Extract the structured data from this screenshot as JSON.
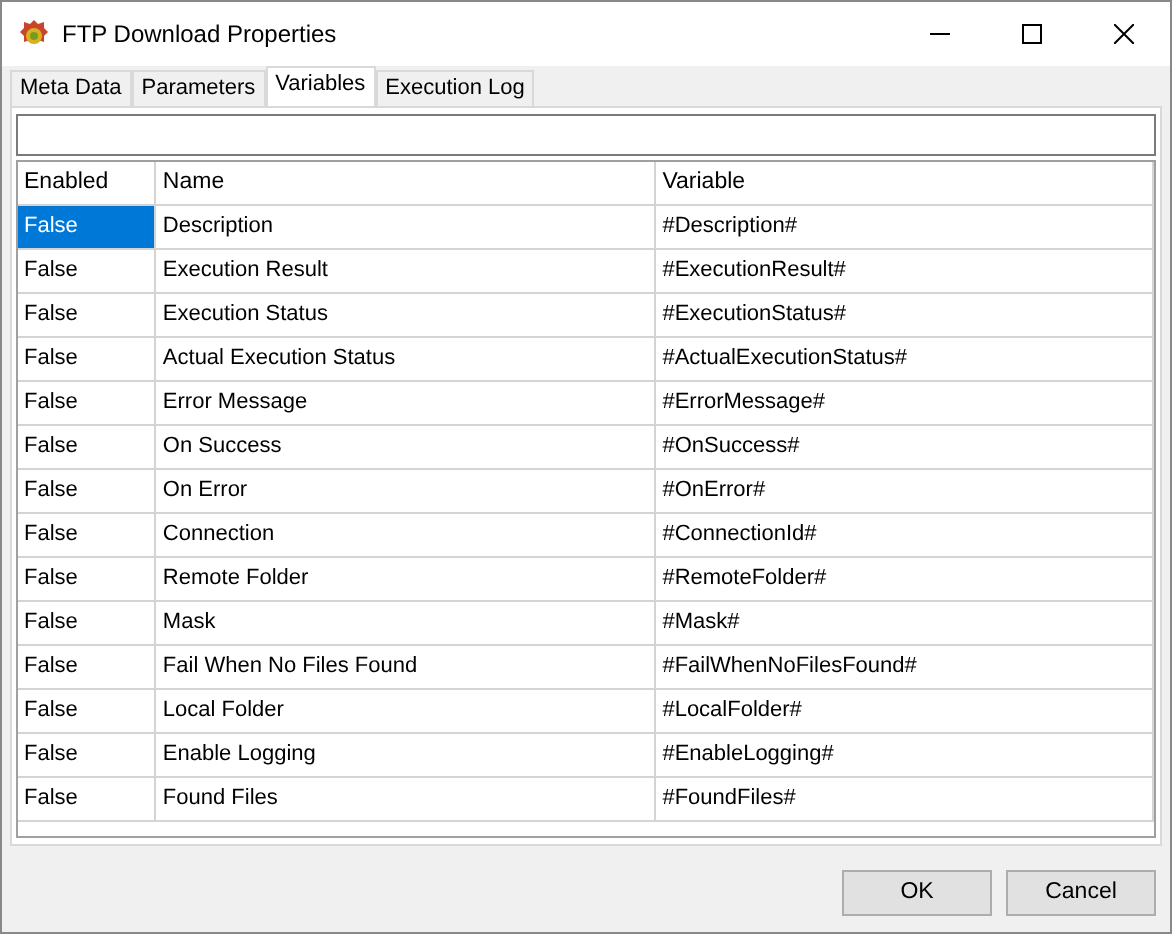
{
  "window": {
    "title": "FTP Download Properties"
  },
  "tabs": [
    {
      "label": "Meta Data",
      "selected": false
    },
    {
      "label": "Parameters",
      "selected": false
    },
    {
      "label": "Variables",
      "selected": true
    },
    {
      "label": "Execution Log",
      "selected": false
    }
  ],
  "table": {
    "columns": [
      "Enabled",
      "Name",
      "Variable"
    ],
    "rows": [
      {
        "enabled": "False",
        "name": "Description",
        "variable": "#Description#",
        "selected": true
      },
      {
        "enabled": "False",
        "name": "Execution Result",
        "variable": "#ExecutionResult#",
        "selected": false
      },
      {
        "enabled": "False",
        "name": "Execution Status",
        "variable": "#ExecutionStatus#",
        "selected": false
      },
      {
        "enabled": "False",
        "name": "Actual Execution Status",
        "variable": "#ActualExecutionStatus#",
        "selected": false
      },
      {
        "enabled": "False",
        "name": "Error Message",
        "variable": "#ErrorMessage#",
        "selected": false
      },
      {
        "enabled": "False",
        "name": "On Success",
        "variable": "#OnSuccess#",
        "selected": false
      },
      {
        "enabled": "False",
        "name": "On Error",
        "variable": "#OnError#",
        "selected": false
      },
      {
        "enabled": "False",
        "name": "Connection",
        "variable": "#ConnectionId#",
        "selected": false
      },
      {
        "enabled": "False",
        "name": "Remote Folder",
        "variable": "#RemoteFolder#",
        "selected": false
      },
      {
        "enabled": "False",
        "name": "Mask",
        "variable": "#Mask#",
        "selected": false
      },
      {
        "enabled": "False",
        "name": "Fail When No Files Found",
        "variable": "#FailWhenNoFilesFound#",
        "selected": false
      },
      {
        "enabled": "False",
        "name": "Local Folder",
        "variable": "#LocalFolder#",
        "selected": false
      },
      {
        "enabled": "False",
        "name": "Enable Logging",
        "variable": "#EnableLogging#",
        "selected": false
      },
      {
        "enabled": "False",
        "name": "Found Files",
        "variable": "#FoundFiles#",
        "selected": false
      }
    ]
  },
  "buttons": [
    "OK",
    "Cancel"
  ]
}
